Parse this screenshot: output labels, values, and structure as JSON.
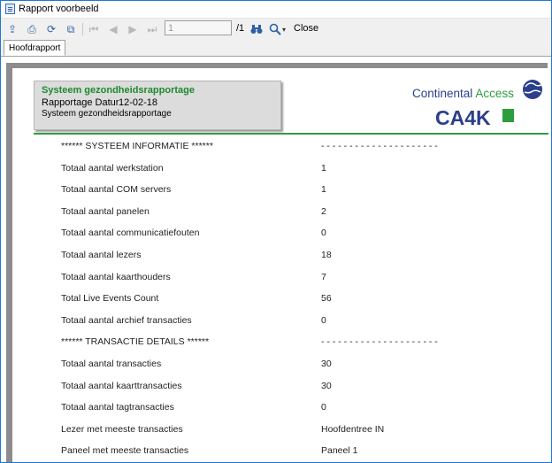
{
  "window": {
    "title": "Rapport voorbeeld"
  },
  "toolbar": {
    "page_input": "1",
    "page_total": "/1",
    "close_label": "Close"
  },
  "tabs": [
    {
      "label": "Hoofdrapport"
    }
  ],
  "report": {
    "header": {
      "title": "Systeem gezondheidsrapportage",
      "date_label": "Rapportage Datur",
      "date_value": "12-02-18",
      "subtitle": "Systeem gezondheidsrapportage"
    },
    "logo": {
      "text_main": "Continental ",
      "text_accent": "Access",
      "mark": "CA4K"
    },
    "rows": [
      {
        "label": "******   SYSTEEM INFORMATIE   ******",
        "value": "- - - - - - - - - - - - - - - - - - - - -"
      },
      {
        "label": "Totaal aantal werkstation",
        "value": "1"
      },
      {
        "label": "Totaal aantal COM servers",
        "value": "1"
      },
      {
        "label": "Totaal aantal panelen",
        "value": "2"
      },
      {
        "label": "Totaal aantal communicatiefouten",
        "value": "0"
      },
      {
        "label": "Totaal aantal lezers",
        "value": "18"
      },
      {
        "label": "Totaal aantal kaarthouders",
        "value": "7"
      },
      {
        "label": "Total Live Events Count",
        "value": "56"
      },
      {
        "label": "Totaal aantal archief transacties",
        "value": "0"
      },
      {
        "label": "******   TRANSACTIE DETAILS   ******",
        "value": "- - - - - - - - - - - - - - - - - - - - -"
      },
      {
        "label": "Totaal aantal transacties",
        "value": "30"
      },
      {
        "label": "Totaal aantal kaarttransacties",
        "value": "30"
      },
      {
        "label": "Totaal aantal tagtransacties",
        "value": "0"
      },
      {
        "label": "Lezer met meeste transacties",
        "value": "Hoofdentree IN"
      },
      {
        "label": "Paneel met meeste transacties",
        "value": "Paneel 1"
      }
    ]
  }
}
